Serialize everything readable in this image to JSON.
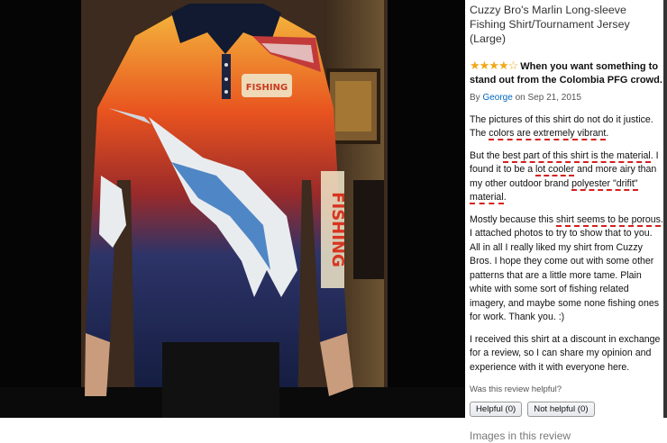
{
  "product": {
    "title": "Cuzzy Bro's Marlin Long-sleeve Fishing Shirt/Tournament Jersey (Large)"
  },
  "review": {
    "stars": "★★★★",
    "empty_star": "☆",
    "headline": "When you want something to stand out from the Colombia PFG crowd.",
    "by": "By",
    "author": "George",
    "date_prefix": "on",
    "date": "Sep 21, 2015",
    "p1": {
      "a": "The pictures of this shirt do not do it justice. The ",
      "u1": "colors are extremely vibrant",
      "b": "."
    },
    "p2": {
      "a": "But the ",
      "u1": "best part of this shirt is the material",
      "b": ". I found it to be a ",
      "u2": "lot cooler",
      "c": " and more airy than my other outdoor brand ",
      "u3": "polyester \"drifit\" material",
      "d": "."
    },
    "p3": {
      "a": "Mostly because this ",
      "u1": "shirt seems to be porous",
      "b": ". I attached photos to try to show that to you. All in all I really liked my shirt from Cuzzy Bros. I hope they come out with some other patterns that are a little more tame. Plain white with some sort of fishing related imagery, and maybe some none fishing ones for work. Thank you. :)"
    },
    "p4": "I received this shirt at a discount in exchange for a review, so I can share my opinion and experience with it with everyone here.",
    "helpful_question": "Was this review helpful?",
    "helpful_button": "Helpful (0)",
    "not_helpful_button": "Not helpful (0)",
    "images_heading": "Images in this review"
  },
  "photo": {
    "logo_text": "FISHING",
    "sleeve_text": "FISHING"
  },
  "colors": {
    "link": "#0066c0",
    "star": "#f0a81a",
    "underline": "#d61f1f"
  }
}
